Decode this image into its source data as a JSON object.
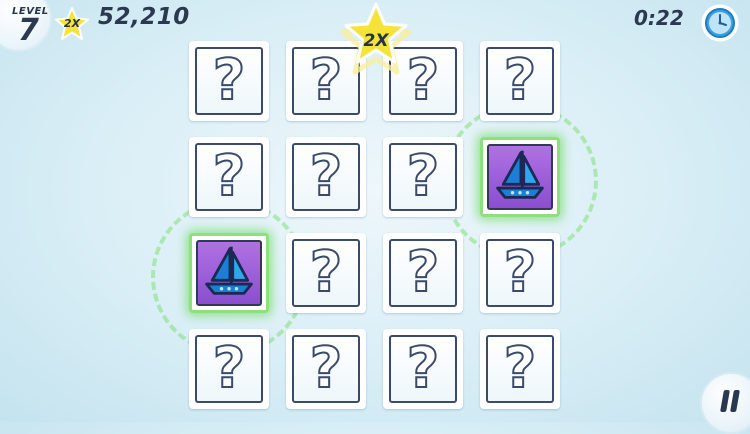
{
  "hud": {
    "level_label": "LEVEL",
    "level_number": "7",
    "multiplier": "2X",
    "score": "52,210",
    "timer": "0:22"
  },
  "center_bonus": "2X",
  "card_symbol": "?",
  "colors": {
    "card_border": "#3b4a6b",
    "revealed_card": "#9b5fd9",
    "match_glow": "#8ee07e",
    "star": "#f6e33a"
  },
  "icons": {
    "clock": "clock-icon",
    "pause": "pause-icon",
    "revealed_symbol": "sailboat-icon",
    "multiplier": "star-icon"
  }
}
